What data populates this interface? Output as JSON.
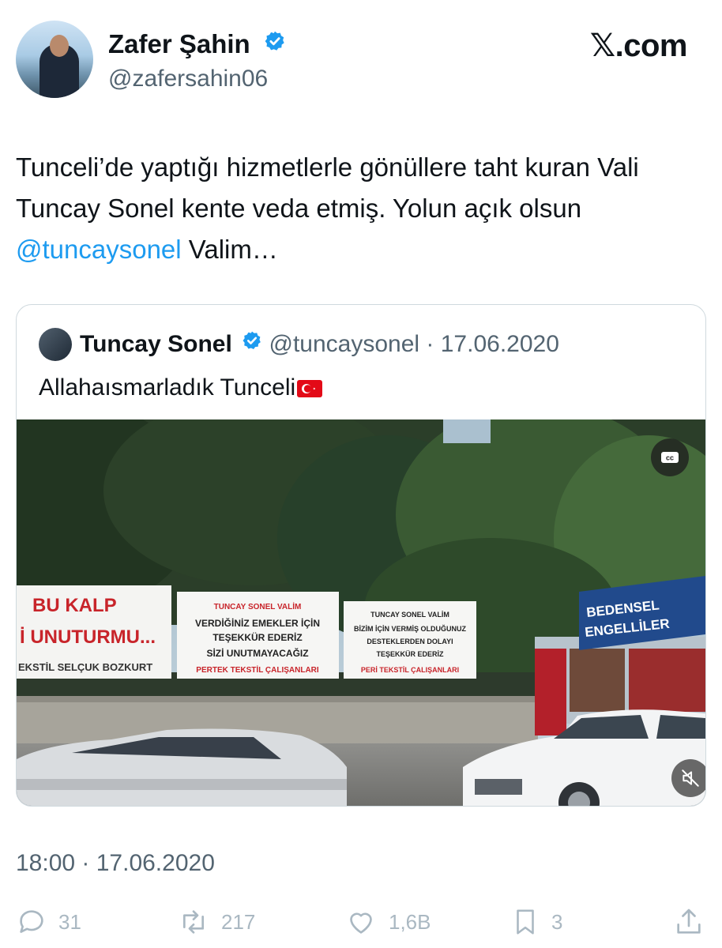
{
  "author": {
    "name": "Zafer Şahin",
    "handle": "@zafersahin06"
  },
  "brand": "𝕏.com",
  "tweet": {
    "text_part1": "Tunceli’de yaptığı hizmetlerle gönüllere taht kuran Vali Tuncay Sonel kente veda etmiş. Yolun açık olsun ",
    "mention": "@tuncaysonel",
    "text_part2": " Valim…",
    "timestamp": "18:00 · 17.06.2020"
  },
  "quote": {
    "name": "Tuncay Sonel",
    "handle": "@tuncaysonel",
    "date": "17.06.2020",
    "text": "Allahaısmarladık Tunceli",
    "video": {
      "banner1_line1": "BU KALP",
      "banner1_line2": "İ UNUTURMU...",
      "banner1_line3": "EKSTİL SELÇUK BOZKURT",
      "banner2_line1": "TUNCAY SONEL VALİM",
      "banner2_line2": "VERDİĞİNİZ EMEKLER İÇİN",
      "banner2_line3": "TEŞEKKÜR EDERİZ",
      "banner2_line4": "SİZİ UNUTMAYACAĞIZ",
      "banner2_line5": "PERTEK TEKSTİL ÇALIŞANLARI",
      "banner3_line1": "TUNCAY SONEL VALİM",
      "banner3_line2": "BİZİM İÇİN VERMİŞ OLDUĞUNUZ",
      "banner3_line3": "DESTEKLERDEN DOLAYI",
      "banner3_line4": "TEŞEKKÜR EDERİZ",
      "banner3_line5": "PERİ TEKSTİL ÇALIŞANLARI",
      "sign_line1": "BEDENSEL",
      "sign_line2": "ENGELLİLER",
      "cc_label": "cc"
    }
  },
  "actions": {
    "replies": "31",
    "reposts": "217",
    "likes": "1,6B",
    "bookmarks": "3"
  },
  "icons": [
    "verified-badge-icon",
    "cc-icon",
    "mute-icon",
    "reply-icon",
    "repost-icon",
    "like-icon",
    "bookmark-icon",
    "share-icon"
  ],
  "colors": {
    "link": "#1d9bf0",
    "verified": "#1d9bf0",
    "secondary_text": "#536471",
    "action_icons": "#aab8c2"
  }
}
